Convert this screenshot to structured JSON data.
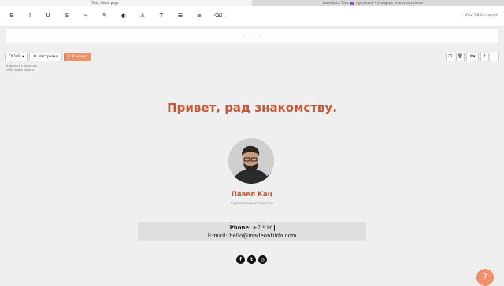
{
  "tabs": [
    {
      "label": "Tilda: Blank page"
    },
    {
      "label": "Pavel Kats, Tilda",
      "label_rest": "(@mnkats) • Instagram photos and videos"
    }
  ],
  "toolbar": {
    "tools": [
      {
        "icon": "bold-icon",
        "glyph": "B"
      },
      {
        "icon": "italic-icon",
        "glyph": "I"
      },
      {
        "icon": "underline-icon",
        "glyph": "U"
      },
      {
        "icon": "strikethrough-icon",
        "glyph": "S"
      },
      {
        "icon": "link-icon",
        "glyph": "∞"
      },
      {
        "icon": "pen-icon",
        "glyph": "✎"
      },
      {
        "icon": "contrast-icon",
        "glyph": "◐"
      },
      {
        "icon": "font-icon",
        "glyph": "A"
      },
      {
        "icon": "text-size-icon",
        "glyph": "T"
      },
      {
        "icon": "list-icon",
        "glyph": "☰"
      },
      {
        "icon": "align-icon",
        "glyph": "≡"
      },
      {
        "icon": "eraser-icon",
        "glyph": "⌫"
      }
    ],
    "font_info": "20px, 'EB Garamond'"
  },
  "editbox": {
    "dots": "• • • • • •"
  },
  "block_controls": {
    "block_id": "CN108",
    "settings": "Настройки",
    "content": "Контент"
  },
  "note": "Кликните с зажатым shift, чтобы скрыть",
  "content": {
    "headline": "Привет, рад знакомству.",
    "name": "Павел Кац",
    "role": "Управляющий партнер",
    "phone_label": "Phone:",
    "phone_value": "+7 916",
    "email_label": "E-mail:",
    "email_value": "hello@madeontilda.com"
  },
  "socials": [
    {
      "icon": "facebook-icon",
      "glyph": "f"
    },
    {
      "icon": "twitter-icon",
      "glyph": "t"
    },
    {
      "icon": "instagram-icon",
      "glyph": "◎"
    }
  ],
  "help": {
    "glyph": "?"
  },
  "colors": {
    "accent": "#c75536",
    "button_accent": "#f0906a",
    "tab_badge": "#8a4fd6"
  }
}
